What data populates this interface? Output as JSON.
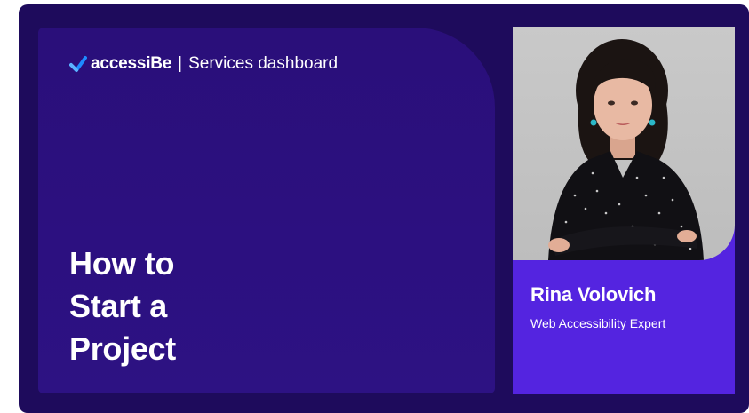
{
  "brand": {
    "name": "accessiBe",
    "separator": "|",
    "section": "Services dashboard",
    "logo_icon": "checkmark-logo-icon"
  },
  "headline": {
    "lines": [
      "How to",
      "Start a",
      "Project"
    ]
  },
  "presenter": {
    "name": "Rina Volovich",
    "role": "Web Accessibility Expert",
    "photo": "presenter-photo"
  },
  "colors": {
    "card_background": "#1e0b5c",
    "panel_background": "#2c1080",
    "accent": "#5424e0",
    "text": "#ffffff"
  }
}
